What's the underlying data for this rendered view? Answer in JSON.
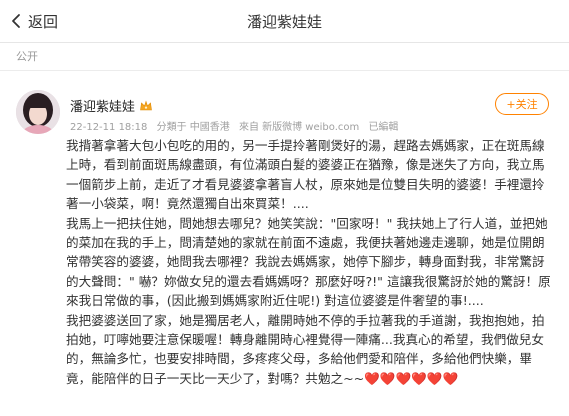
{
  "topbar": {
    "back_label": "返回",
    "title": "潘迎紫娃娃"
  },
  "visibility": "公开",
  "post": {
    "username": "潘迎紫娃娃",
    "follow_label": "+关注",
    "time": "22-12-11 18:18",
    "from": "分類于 中國香港",
    "source": "來自 新版微博 weibo.com",
    "edited": "已編輯",
    "paragraphs": [
      "我揹著拿著大包小包吃的用的，另一手提拎著剛煲好的湯，趕路去媽媽家，正在斑馬線上時，看到前面斑馬線盡頭，有位滿頭白髮的婆婆正在猶豫，像是迷失了方向，我立馬一個箭步上前，走近了才看見婆婆拿著盲人杖，原來她是位雙目失明的婆婆！手裡還拎著一小袋菜，啊！竟然還獨自出來買菜！....",
      "我馬上一把扶住她，問她想去哪兒？她笑笑說：\"回家呀！\" 我扶她上了行人道，並把她的菜加在我的手上，問清楚她的家就在前面不遠處，我便扶著她邊走邊聊，她是位開朗常帶笑容的婆婆，她問我去哪裡？我說去媽媽家，她停下腳步，轉身面對我，非常驚訝的大聲問：\" 嚇？妳做女兒的還去看媽媽呀？那麼好呀?!\" 這讓我很驚訝於她的驚訝！原來我日常做的事，(因此搬到媽媽家附近住呢!) 對這位婆婆是件奢望的事!....",
      "我把婆婆送回了家，她是獨居老人，離開時她不停的手拉著我的手道謝，我抱抱她，拍拍她，叮嚀她要注意保暖喔！轉身離開時心裡覺得一陣痛...我真心的希望，我們做兒女的，無論多忙，也要安排時間，多疼疼父母，多給他們愛和陪伴，多給他們快樂，畢竟，能陪伴的日子一天比一天少了，對嗎？共勉之~~"
    ],
    "hearts": "❤️❤️❤️❤️❤️❤️"
  },
  "colors": {
    "accent": "#ff8200",
    "meta": "#a0a0a0",
    "heart": "#e63030"
  },
  "icons": [
    "chevron-left-icon",
    "crown-icon"
  ]
}
